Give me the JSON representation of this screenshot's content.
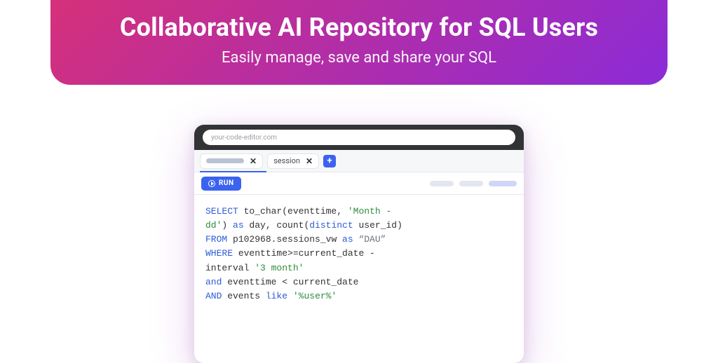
{
  "hero": {
    "title": "Collaborative AI Repository for SQL Users",
    "subtitle": "Easily manage, save and share your SQL"
  },
  "editor": {
    "url": "your-code-editor.com",
    "tabs": [
      {
        "label": ""
      },
      {
        "label": "session"
      }
    ],
    "run_label": "RUN",
    "code": {
      "l1a": "SELECT",
      "l1b": " to_char(eventtime, ",
      "l1c": "'Month -",
      "l2a": "dd'",
      "l2b": ") ",
      "l2c": "as",
      "l2d": " day, count(",
      "l2e": "distinct",
      "l2f": " user_id)",
      "l3a": "FROM",
      "l3b": " p102968.sessions_vw ",
      "l3c": "as",
      "l3d": " “DAU”",
      "l4a": "WHERE",
      "l4b": " eventtime>=current_date -",
      "l5a": "interval ",
      "l5b": "'3 month'",
      "l6a": "and",
      "l6b": " eventtime < current_date",
      "l7a": "AND",
      "l7b": " events ",
      "l7c": "like",
      "l7d": " ",
      "l7e": "'%user%'"
    }
  }
}
